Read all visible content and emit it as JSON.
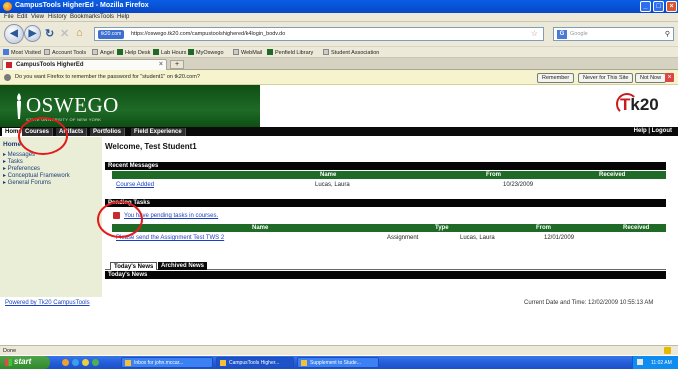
{
  "window": {
    "title": "CampusTools HigherEd - Mozilla Firefox",
    "buttons": {
      "min": "_",
      "max": "□",
      "close": "×"
    }
  },
  "menu": [
    "File",
    "Edit",
    "View",
    "History",
    "Bookmarks",
    "Tools",
    "Help"
  ],
  "toolbar": {
    "url_site": "tk20.com",
    "url": "https://oswego.tk20.com/campustoolshighered/k4login_bodv.do",
    "search_engine": "G",
    "search_placeholder": "Google"
  },
  "bookmarks": [
    "Most Visited",
    "Account Tools",
    "Angel",
    "Help Desk",
    "Lab Hours",
    "MyOswego",
    "WebMail",
    "Penfield Library",
    "Student Association"
  ],
  "tab": {
    "label": "CampusTools HigherEd",
    "new": "+"
  },
  "notification": {
    "message": "Do you want Firefox to remember the password for \"student1\" on tk20.com?",
    "remember": "Remember",
    "never": "Never for This Site",
    "not_now": "Not Now"
  },
  "header": {
    "brand": "OSWEGO",
    "sub": "STATE UNIVERSITY OF NEW YORK",
    "tk20_t": "T",
    "tk20_rest": "k20"
  },
  "nav": {
    "tabs": [
      "Home",
      "Courses",
      "Artifacts",
      "Portfolios",
      "Field Experience"
    ],
    "help_logout": "Help | Logout"
  },
  "sidebar": {
    "heading": "Home",
    "items": [
      "▸ Messages",
      "▸ Tasks",
      "▸ Preferences",
      "▸ Conceptual Framework",
      "▸ General Forums"
    ]
  },
  "main": {
    "welcome": "Welcome, Test Student1",
    "recent_messages": {
      "title": "Recent Messages",
      "columns": [
        "Name",
        "From",
        "Received"
      ],
      "rows": [
        {
          "name": "Course Added",
          "from": "Lucas, Laura",
          "received": "10/23/2009"
        }
      ]
    },
    "pending_tasks": {
      "title": "Pending Tasks",
      "notice": "You have pending tasks in courses.",
      "columns": [
        "Name",
        "Type",
        "From",
        "Received"
      ],
      "rows": [
        {
          "name": "Please send the Assignment Test TWS 2",
          "type": "Assignment",
          "from": "Lucas, Laura",
          "received": "12/01/2009"
        }
      ]
    },
    "news": {
      "tabs": [
        "Today's News",
        "Archived News"
      ],
      "title": "Today's News"
    }
  },
  "footer": {
    "powered": "Powered by Tk20 CampusTools",
    "datetime": "Current Date and Time: 12/02/2009 10:55:13 AM"
  },
  "status": {
    "text": "Done"
  },
  "taskbar": {
    "start": "start",
    "tasks": [
      "Inbox for john.mccar...",
      "CampusTools Higher...",
      "Supplement to Stude..."
    ],
    "time": "11:02 AM"
  },
  "colors": {
    "oswego_green": "#1f6a26",
    "tk20_red": "#c91d1d",
    "annotation_red": "#e21c1c"
  }
}
